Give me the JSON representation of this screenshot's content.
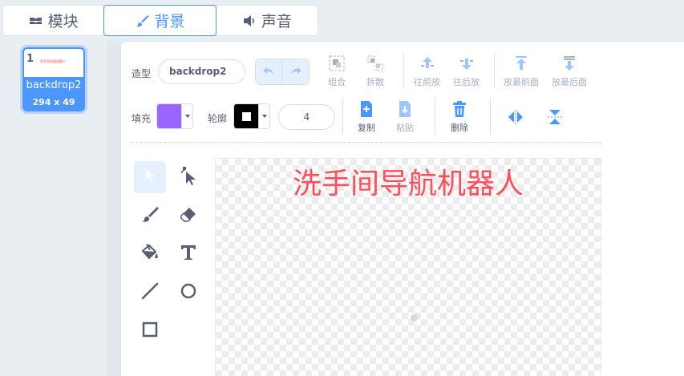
{
  "tabs": [
    {
      "label": "模块",
      "icon": "code-blocks-icon"
    },
    {
      "label": "背景",
      "icon": "paintbrush-icon",
      "active": true
    },
    {
      "label": "声音",
      "icon": "speaker-icon"
    }
  ],
  "costumes": [
    {
      "number": "1",
      "name": "backdrop2",
      "size": "294 x 49",
      "thumb_text": "洗手间导航机器人",
      "selected": true
    }
  ],
  "editor": {
    "costume_label": "造型",
    "costume_name": "backdrop2",
    "fill_label": "填充",
    "outline_label": "轮廓",
    "stroke_width": "4",
    "buttons": {
      "group": "组合",
      "ungroup": "拆散",
      "forward": "往前放",
      "backward": "往后放",
      "front": "放最前面",
      "back": "放最后面",
      "copy": "复制",
      "paste": "粘贴",
      "delete": "删除"
    },
    "colors": {
      "fill": "#9966ff",
      "outline": "#000000",
      "accent": "#4c97ff",
      "canvas_text": "#ff4d5a"
    }
  },
  "canvas": {
    "text": "洗手间导航机器人"
  }
}
